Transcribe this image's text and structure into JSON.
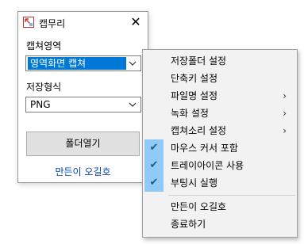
{
  "window": {
    "title": "캡무리",
    "close_glyph": "✕",
    "capture_area_label": "캡쳐영역",
    "capture_area_value": "영역화면 캡쳐",
    "save_format_label": "저장형식",
    "save_format_value": "PNG",
    "folder_button_label": "폴더열기",
    "author_link_label": "만든이 오길호"
  },
  "menu": {
    "items": [
      {
        "label": "저장폴더 설정",
        "checked": false,
        "submenu": false
      },
      {
        "label": "단축키 설정",
        "checked": false,
        "submenu": false
      },
      {
        "label": "파일명 설정",
        "checked": false,
        "submenu": true
      },
      {
        "label": "녹화 설정",
        "checked": false,
        "submenu": true
      },
      {
        "label": "캡쳐소리 설정",
        "checked": false,
        "submenu": true
      },
      {
        "label": "마우스 커서 포함",
        "checked": true,
        "submenu": false
      },
      {
        "label": "트레이아이콘 사용",
        "checked": true,
        "submenu": false
      },
      {
        "label": "부팅시 실행",
        "checked": true,
        "submenu": false
      },
      {
        "label": "만든이 오길호",
        "checked": false,
        "submenu": false
      },
      {
        "label": "종료하기",
        "checked": false,
        "submenu": false
      }
    ],
    "check_glyph": "✔",
    "submenu_glyph": "›"
  },
  "colors": {
    "selection": "#0078d7",
    "check_highlight": "#91c9f7",
    "link": "#0645ad",
    "button_face": "#e1e1e1",
    "menu_bg": "#f2f2f2"
  }
}
